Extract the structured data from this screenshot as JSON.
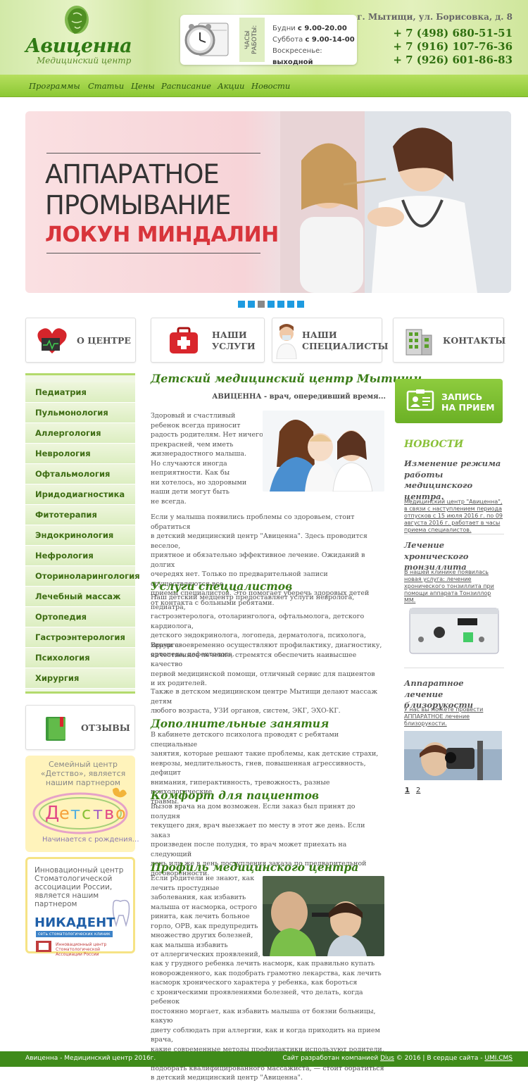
{
  "brand": {
    "name": "Авиценна",
    "subtitle": "Медицинский центр"
  },
  "hours": {
    "label": "ЧАСЫ РАБОТЫ:",
    "lines": [
      {
        "day": "Будни",
        "time": "с 9.00-20.00"
      },
      {
        "day": "Суббота",
        "time": "с 9.00-14-00"
      },
      {
        "day": "Воскресенье:",
        "time": "выходной"
      }
    ]
  },
  "contact": {
    "address": "г. Мытищи, ул. Борисовка, д. 8",
    "phones": [
      "+ 7 (498) 680-51-51",
      "+ 7 (916) 107-76-36",
      "+ 7 (926) 601-86-83"
    ]
  },
  "nav": [
    "Программы",
    "Статьи",
    "Цены",
    "Расписание",
    "Акции",
    "Новости"
  ],
  "banner": {
    "line1": "АППАРАТНОЕ",
    "line2": "ПРОМЫВАНИЕ",
    "line3": "ЛОКУН МИНДАЛИН",
    "slides": 7,
    "active_slide": 3
  },
  "tiles": [
    {
      "label": "О ЦЕНТРЕ",
      "icon": "heart-monitor-icon"
    },
    {
      "label": "НАШИ\nУСЛУГИ",
      "icon": "first-aid-kit-icon"
    },
    {
      "label": "НАШИ\nСПЕЦИАЛИСТЫ",
      "icon": "doctor-icon"
    },
    {
      "label": "КОНТАКТЫ",
      "icon": "building-icon"
    }
  ],
  "sidebar": [
    "Педиатрия",
    "Пульмонология",
    "Аллергология",
    "Неврология",
    "Офтальмология",
    "Иридодиагностика",
    "Фитотерапия",
    "Эндокринология",
    "Нефрология",
    "Оториноларингология",
    "Лечебный массаж",
    "Ортопедия",
    "Гастроэнтерология",
    "Психология",
    "Хирургия"
  ],
  "reviews": {
    "label": "ОТЗЫВЫ",
    "icon": "book-icon"
  },
  "partner1": {
    "text": "Семейный центр «Детство», является нашим партнером",
    "logo": "Детство",
    "tagline": "Начинается с рождения…"
  },
  "partner2": {
    "text": "Инновационный центр Стоматологической ассоциации России, является нашим партнером",
    "brand": "НИКАДЕНТ",
    "brand_sub": "сеть стоматологических клиник",
    "brand_org": "Инновационный центр\nСтоматологической\nАссоциации России"
  },
  "main": {
    "title": "Детский медицинский центр Мытищи",
    "tagline": "АВИЦЕННА - врач, опередивший время...",
    "intro_lines": [
      "Здоровый и счастливый",
      "ребенок всегда приносит",
      "радость родителям. Нет ничего",
      "прекрасней, чем иметь",
      "жизнерадостного малыша.",
      "Но случаются иногда",
      "неприятности. Как бы",
      "ни хотелось, но здоровыми",
      "наши дети могут быть",
      "не всегда."
    ],
    "intro_p2_lines": [
      "Если у малыша появились проблемы со здоровьем, стоит обратиться",
      "в детский медицинский центр \"Авиценна\". Здесь проводится веселое,",
      "приятное и обязательно эффективное лечение. Ожиданий в долгих",
      "очередях нет. Только по предварительной записи осуществляются все",
      "приемы специалистов. Это помогает уберечь здоровых детей",
      "от контакта с больными ребятами."
    ],
    "s1_title": "Услуги специалистов",
    "s1_p1": [
      "Наш детский медцентр предоставляет услуги невролога, педиатра,",
      "гастроэнтеролога, отоларинголога, офтальмолога, детского кардиолога,",
      "детского эндокринолога, логопеда, дерматолога, психолога, хирурга-",
      "ортопеда, дефектолога."
    ],
    "s1_p2": [
      "Врачи своевременно осуществляют профилактику, диагностику,",
      "качественное лечение, стремятся обеспечить наивысшее качество",
      "первой медицинской помощи, отличный сервис для пациентов",
      "и их родителей."
    ],
    "s1_p3": [
      "Также в детском медицинском центре Мытищи делают массаж детям",
      "любого возраста, УЗИ органов, систем, ЭКГ, ЭХО-КГ."
    ],
    "s2_title": "Дополнительные занятия",
    "s2_p": [
      "В кабинете детского психолога проводят с ребятами специальные",
      "занятия, которые решают такие проблемы, как детские страхи,",
      "неврозы, медлительность, гнев, повышенная агрессивность, дефицит",
      "внимания, гиперактивность, тревожность, разные психологические",
      "травмы."
    ],
    "s3_title": "Комфорт для пациентов",
    "s3_p": [
      "Вызов врача на дом возможен. Если заказ был принят до полудня",
      "текущего дня, врач выезжает по месту в этот же день. Если заказ",
      "произведен после полудня, то врач может приехать на следующий",
      "день или же в день поступления заказа по предварительной",
      "договоренности."
    ],
    "s4_title": "Профиль медицинского центра",
    "s4_short": [
      "Если родители не знают, как",
      "лечить простудные",
      "заболевания, как избавить",
      "малыша от насморка, острого",
      "ринита, как лечить больное",
      "горло, ОРВ, как предупредить",
      "множество других болезней,",
      "как малыша избавить",
      "от аллергических проявлений,"
    ],
    "s4_long": [
      "как у грудного ребенка лечить насморк, как правильно купать",
      "новорожденного, как подобрать грамотно лекарства, как лечить",
      "насморк хронического характера у ребенка, как бороться",
      "с хроническими проявлениями болезней, что делать, когда ребенок",
      "постоянно моргает, как избавить малыша от боязни больницы, какую",
      "диету соблюдать при аллергии, как и когда приходить на прием врача,",
      "какие современные методы профилактики используют родители, как",
      "подобрать квалифицированного массажиста, — стоит обратиться",
      "в детский медицинский центр \"Авиценна\"."
    ]
  },
  "appointment": {
    "label": "ЗАПИСЬ\nНА ПРИЕМ",
    "icon": "id-card-icon"
  },
  "news": {
    "heading": "НОВОСТИ",
    "items": [
      {
        "title": "Изменение режима работы медицинского центра.",
        "body": "Медицинский центр \"Авиценна\", в связи с наступлением периода отпусков с 15 июля 2016 г. по 09 августа 2016 г. работает в часы приема специалистов."
      },
      {
        "title": "Лечение хронического тонзиллита",
        "body": "В нашей клинике появилась новая услуга: лечение хронического тонзиллита при помощи аппарата Тонзиллор ММ."
      },
      {
        "title": "Аппаратное лечение близорукости",
        "body": "У нас вы можете провести АППАРАТНОЕ лечение близорукости."
      }
    ],
    "pages": [
      "1",
      "2"
    ]
  },
  "footer": {
    "left": "Авиценна - Медицинский центр 2016г.",
    "right_prefix": "Сайт разработан компанией",
    "dev": "Dius",
    "right_mid": "© 2016 | В сердце сайта -",
    "cms": "UMI.CMS"
  },
  "colors": {
    "green": "#3b7d18",
    "light_green": "#8ac13a",
    "accent_red": "#d8343b",
    "blue_dot": "#1e9be0"
  }
}
